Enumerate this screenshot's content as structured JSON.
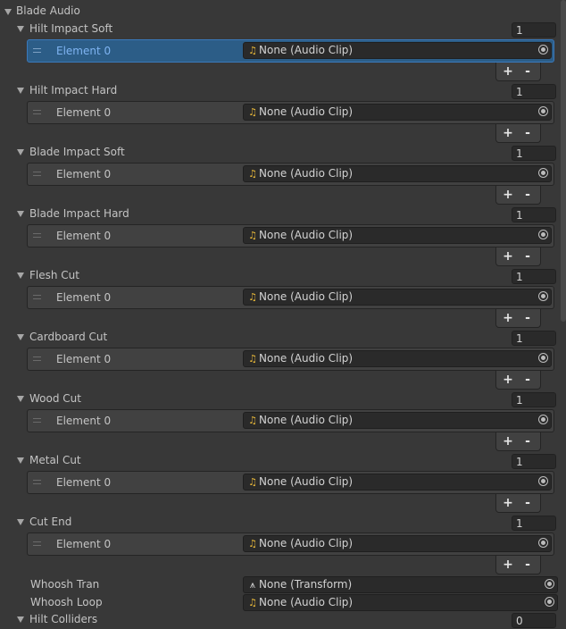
{
  "header": {
    "label": "Blade Audio"
  },
  "element_label": "Element 0",
  "audio_clip_value": "None (Audio Clip)",
  "lists": [
    {
      "label": "Hilt Impact Soft",
      "count": "1",
      "selected": true
    },
    {
      "label": "Hilt Impact Hard",
      "count": "1",
      "selected": false
    },
    {
      "label": "Blade Impact Soft",
      "count": "1",
      "selected": false
    },
    {
      "label": "Blade Impact Hard",
      "count": "1",
      "selected": false
    },
    {
      "label": "Flesh Cut",
      "count": "1",
      "selected": false
    },
    {
      "label": "Cardboard Cut",
      "count": "1",
      "selected": false
    },
    {
      "label": "Wood Cut",
      "count": "1",
      "selected": false
    },
    {
      "label": "Metal Cut",
      "count": "1",
      "selected": false
    },
    {
      "label": "Cut End",
      "count": "1",
      "selected": false
    }
  ],
  "buttons": {
    "plus": "+",
    "minus": "-"
  },
  "whoosh_tran": {
    "label": "Whoosh Tran",
    "value": "None (Transform)",
    "icon": "transform-icon"
  },
  "whoosh_loop": {
    "label": "Whoosh Loop",
    "value": "None (Audio Clip)",
    "icon": "audio-clip-icon"
  },
  "hilt_colliders": {
    "label": "Hilt Colliders",
    "count": "0"
  },
  "colors": {
    "selected_row": "#2c5d87",
    "selected_text": "#7fb4f2",
    "audio_icon": "#e8b83a",
    "background": "#383838"
  }
}
